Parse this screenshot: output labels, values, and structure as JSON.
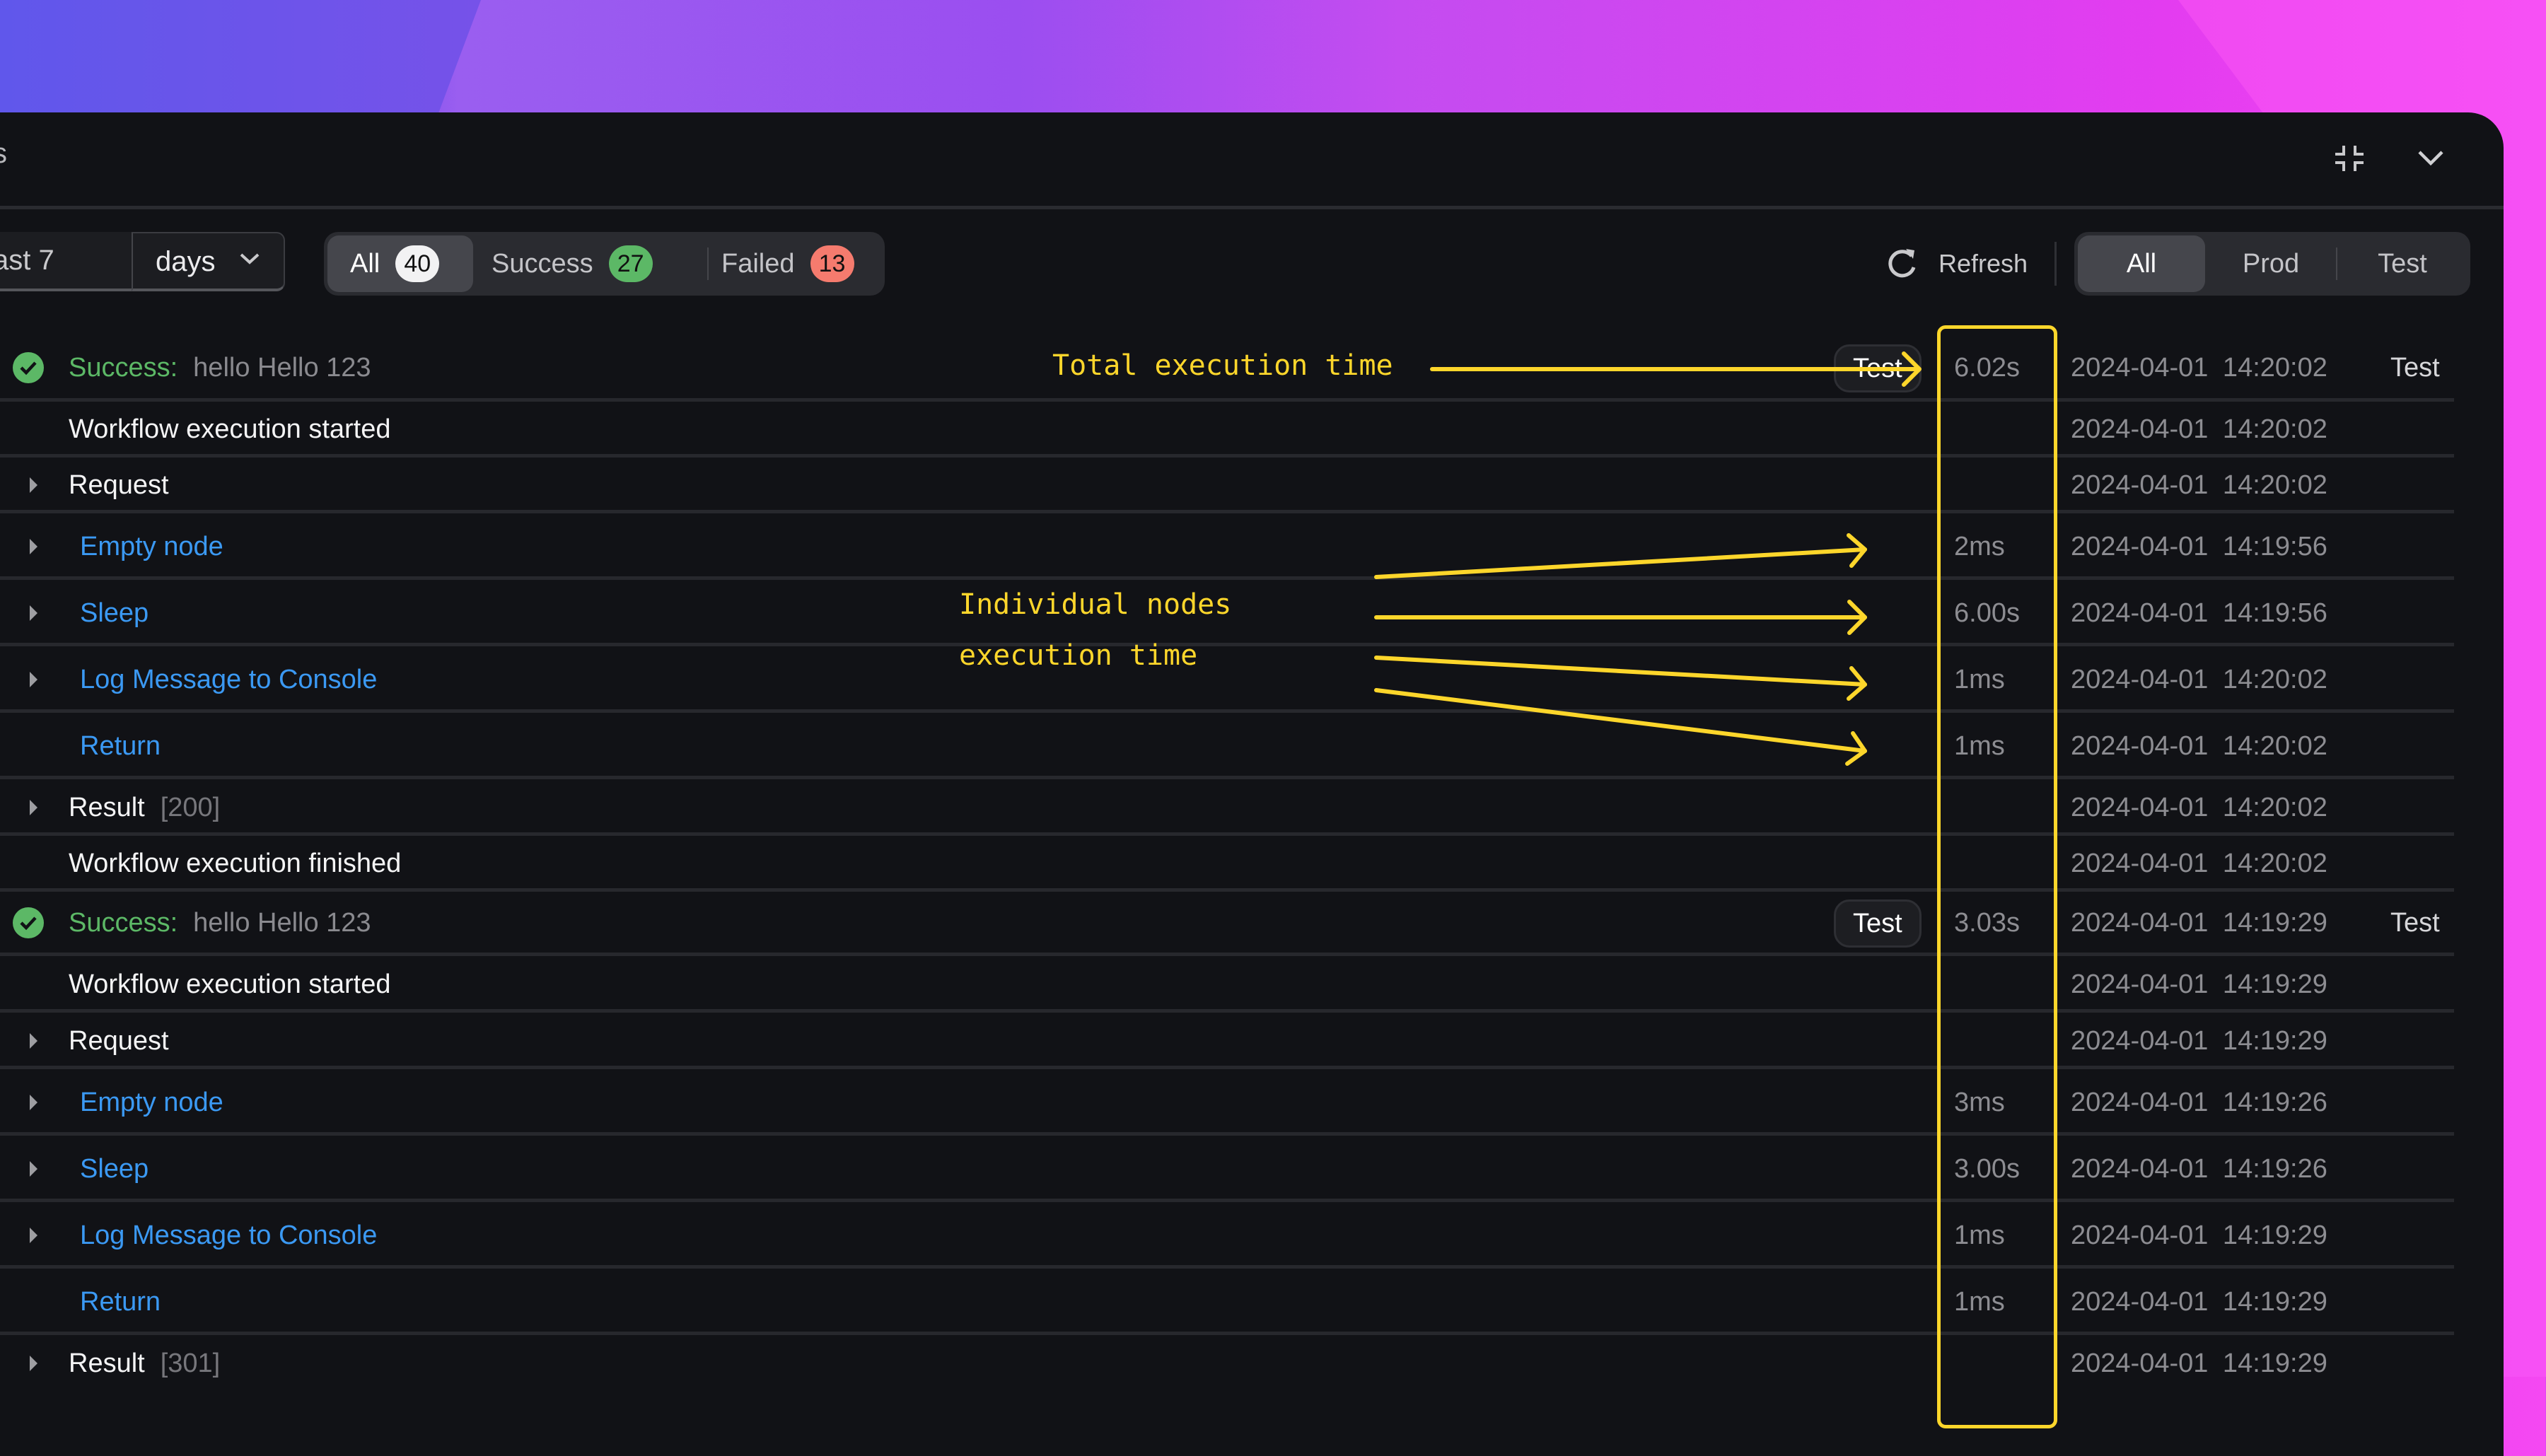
{
  "panel": {
    "title_fragment": "s",
    "collapse_icon": "collapse-icon",
    "chevron_icon": "chevron-down-icon"
  },
  "toolbar": {
    "range_value": "ast 7",
    "range_unit": "days",
    "status_filters": [
      {
        "label": "All",
        "count": "40",
        "active": true,
        "badge_color": "#f2f2f3"
      },
      {
        "label": "Success",
        "count": "27",
        "active": false,
        "badge_color": "#5cb866"
      },
      {
        "label": "Failed",
        "count": "13",
        "active": false,
        "badge_color": "#f57b6e"
      }
    ],
    "refresh_label": "Refresh",
    "env_filters": [
      {
        "label": "All",
        "active": true
      },
      {
        "label": "Prod",
        "active": false
      },
      {
        "label": "Test",
        "active": false
      }
    ]
  },
  "runs": [
    {
      "status": "Success:",
      "summary": "hello Hello 123",
      "env_badge": "Test",
      "duration": "6.02s",
      "timestamp": "2024-04-01 14:20:02",
      "env": "Test",
      "events": [
        {
          "label": "Workflow execution started",
          "kind": "event",
          "expandable": false,
          "timestamp": "2024-04-01 14:20:02"
        },
        {
          "label": "Request",
          "kind": "event",
          "expandable": true,
          "timestamp": "2024-04-01 14:20:02"
        },
        {
          "label": "Empty node",
          "kind": "node",
          "expandable": true,
          "duration": "2ms",
          "timestamp": "2024-04-01 14:19:56"
        },
        {
          "label": "Sleep",
          "kind": "node",
          "expandable": true,
          "duration": "6.00s",
          "timestamp": "2024-04-01 14:19:56"
        },
        {
          "label": "Log Message to Console",
          "kind": "node",
          "expandable": true,
          "duration": "1ms",
          "timestamp": "2024-04-01 14:20:02"
        },
        {
          "label": "Return",
          "kind": "node",
          "expandable": false,
          "duration": "1ms",
          "timestamp": "2024-04-01 14:20:02"
        },
        {
          "label": "Result",
          "extra": "[200]",
          "kind": "event",
          "expandable": true,
          "timestamp": "2024-04-01 14:20:02"
        },
        {
          "label": "Workflow execution finished",
          "kind": "event",
          "expandable": false,
          "timestamp": "2024-04-01 14:20:02"
        }
      ]
    },
    {
      "status": "Success:",
      "summary": "hello Hello 123",
      "env_badge": "Test",
      "duration": "3.03s",
      "timestamp": "2024-04-01 14:19:29",
      "env": "Test",
      "events": [
        {
          "label": "Workflow execution started",
          "kind": "event",
          "expandable": false,
          "timestamp": "2024-04-01 14:19:29"
        },
        {
          "label": "Request",
          "kind": "event",
          "expandable": true,
          "timestamp": "2024-04-01 14:19:29"
        },
        {
          "label": "Empty node",
          "kind": "node",
          "expandable": true,
          "duration": "3ms",
          "timestamp": "2024-04-01 14:19:26"
        },
        {
          "label": "Sleep",
          "kind": "node",
          "expandable": true,
          "duration": "3.00s",
          "timestamp": "2024-04-01 14:19:26"
        },
        {
          "label": "Log Message to Console",
          "kind": "node",
          "expandable": true,
          "duration": "1ms",
          "timestamp": "2024-04-01 14:19:29"
        },
        {
          "label": "Return",
          "kind": "node",
          "expandable": false,
          "duration": "1ms",
          "timestamp": "2024-04-01 14:19:29"
        },
        {
          "label": "Result",
          "extra": "[301]",
          "kind": "event",
          "expandable": true,
          "timestamp": "2024-04-01 14:19:29"
        }
      ]
    }
  ],
  "annotations": {
    "total_label": "Total execution time",
    "nodes_label_line1": "Individual nodes",
    "nodes_label_line2": "execution time",
    "color": "#fdd62b"
  },
  "colors": {
    "panel_bg": "#111216",
    "success": "#5cb866",
    "failed": "#f57b6e",
    "node_link": "#3b99f3",
    "annotation": "#fdd62b"
  }
}
